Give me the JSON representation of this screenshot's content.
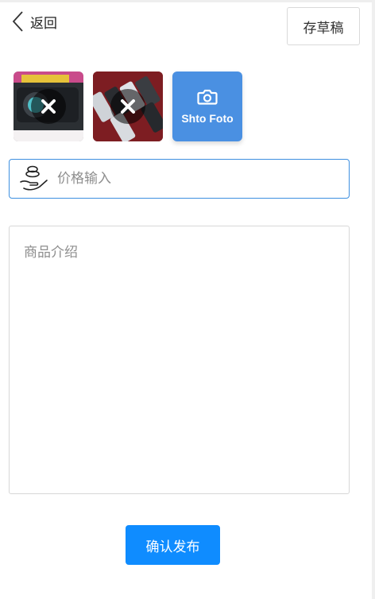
{
  "header": {
    "back_label": "返回",
    "draft_label": "存草稿"
  },
  "photos": {
    "items": [
      {
        "icon": "remove-icon"
      },
      {
        "icon": "remove-icon"
      }
    ],
    "add_label": "Shto Foto"
  },
  "price": {
    "placeholder": "价格输入",
    "value": ""
  },
  "description": {
    "placeholder": "商品介绍",
    "value": ""
  },
  "submit_label": "确认发布",
  "colors": {
    "accent": "#0f8cff",
    "photo_button": "#4a90e2",
    "input_border": "#3d8fe0"
  }
}
